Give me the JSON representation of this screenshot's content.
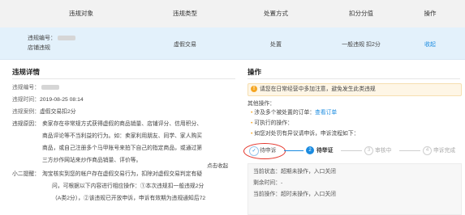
{
  "table": {
    "headers": [
      "违规对象",
      "违规类型",
      "处置方式",
      "扣分分值",
      "操作"
    ],
    "row": {
      "object_line1": "违规编号：",
      "object_line2": "店铺违规",
      "type": "虚假交易",
      "action": "处置",
      "score": "一般违规 扣2分",
      "operation": "收起"
    }
  },
  "detail": {
    "title": "违规详情",
    "id_label": "违规编号：",
    "time_label": "违规时间：",
    "time_value": "2019-08-25 08:14",
    "case_label": "违规案例：",
    "case_value": "虚假交易扣2分",
    "reason_label": "违规原因：",
    "reason_lines": [
      "卖家存在非常规方式获得虚假的商品销量、店铺评分、信用积分、",
      "商品评论等不当利益的行为。如：卖家利用朋友、同学、家人购买",
      "商品，或自己注册多个马甲账号来拍下自己的指定商品，或通过第",
      "三方炒作网站来炒作商品销量、评价等。"
    ],
    "more_link": "点击收起",
    "tip_label": "小二提醒：",
    "tip_lines": [
      "淘宝核实到您的帐户存在虚假交易行为，扣除对虚假交易判定有疑",
      "问，可根据以下内容进行相应操作：①本次违规扣一般违规2分",
      "（A类2分），②该违规已开放申诉，申诉有效期为违规通知后72"
    ]
  },
  "operation": {
    "title": "操作",
    "notice": "请您在日常经营中多加注意，避免发生此类违规",
    "other_ops_label": "其他操作：",
    "items": [
      {
        "text": "涉及多个被处置的订单：",
        "link": "查看订单"
      },
      {
        "text": "可执行的操作：",
        "link": ""
      },
      {
        "text": "如您对处罚有异议请申诉，申诉流程如下：",
        "link": ""
      }
    ],
    "steps": [
      {
        "num": "✓",
        "label": "待申诉",
        "state": "done"
      },
      {
        "num": "2",
        "label": "待举证",
        "state": "active"
      },
      {
        "num": "3",
        "label": "审核中",
        "state": "pending"
      },
      {
        "num": "4",
        "label": "申诉完成",
        "state": "pending"
      }
    ],
    "status": {
      "current_label": "当前状态：",
      "current_value": "超期未操作，入口关闭",
      "remaining_label": "剩余时间：",
      "remaining_value": "-",
      "now_label": "当前操作：",
      "now_value": "超时未操作，入口关闭"
    }
  },
  "colors": {
    "link": "#1a8be0",
    "active_step": "#1a8be0",
    "warning": "#f5a623",
    "highlight_ring": "#e4352b"
  }
}
